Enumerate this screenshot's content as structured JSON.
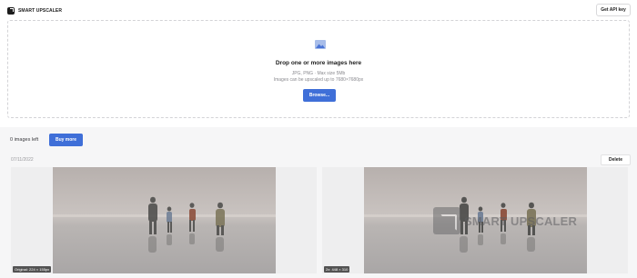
{
  "header": {
    "brand": "SMART UPSCALER",
    "api_button": "Get API key"
  },
  "dropzone": {
    "title": "Drop one or more images here",
    "formats": "JPG, PNG · Max size 5Mb",
    "limit": "Images can be upscaled up to 7680×7680px",
    "browse_button": "Browse..."
  },
  "account": {
    "images_left": "0 images left",
    "buy_button": "Buy more"
  },
  "result": {
    "date": "07/11/2022",
    "delete_button": "Delete",
    "original_tag": "Original: 224 × 155px",
    "upscaled_tag": "2x: 448 × 310",
    "watermark": "SMART UPSCALER"
  }
}
